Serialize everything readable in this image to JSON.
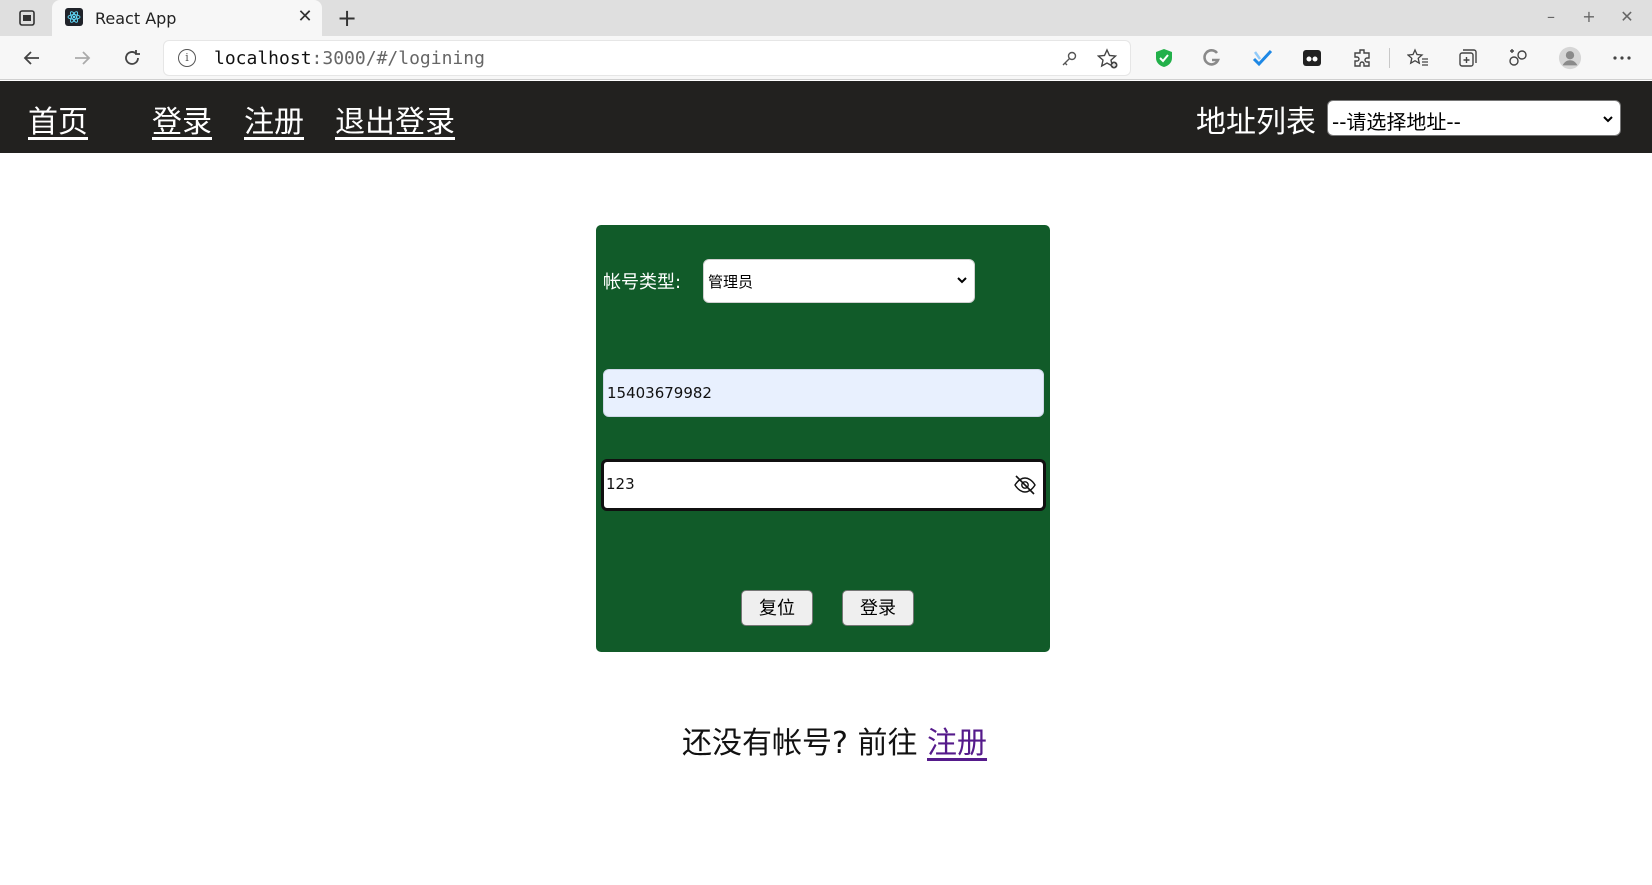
{
  "browser": {
    "tab_title": "React App",
    "url_host": "localhost",
    "url_rest": ":3000/#/logining"
  },
  "nav": {
    "home": "首页",
    "login": "登录",
    "register": "注册",
    "logout": "退出登录",
    "address_list_label": "地址列表",
    "address_select_value": "--请选择地址--"
  },
  "login_form": {
    "account_type_label": "帐号类型:",
    "account_type_value": "管理员",
    "account_value": "15403679982",
    "password_value": "123",
    "reset_button": "复位",
    "login_button": "登录"
  },
  "footer": {
    "hint_text": "还没有帐号? 前往",
    "register_link": "注册"
  },
  "colors": {
    "nav_background": "#22211f",
    "card_background": "#115b29",
    "autofill_background": "#e8f0fe",
    "visited_link": "#551a8b"
  },
  "icons": [
    "workspaces-icon",
    "react-favicon-icon",
    "close-icon",
    "plus-icon",
    "back-icon",
    "forward-icon",
    "refresh-icon",
    "info-icon",
    "key-icon",
    "add-favorite-icon",
    "shield-extension-icon",
    "grammarly-extension-icon",
    "check-extension-icon",
    "mask-extension-icon",
    "extensions-icon",
    "favorites-icon",
    "collections-icon",
    "share-icon",
    "profile-icon",
    "more-icon",
    "eye-off-icon",
    "chevron-down-icon"
  ]
}
